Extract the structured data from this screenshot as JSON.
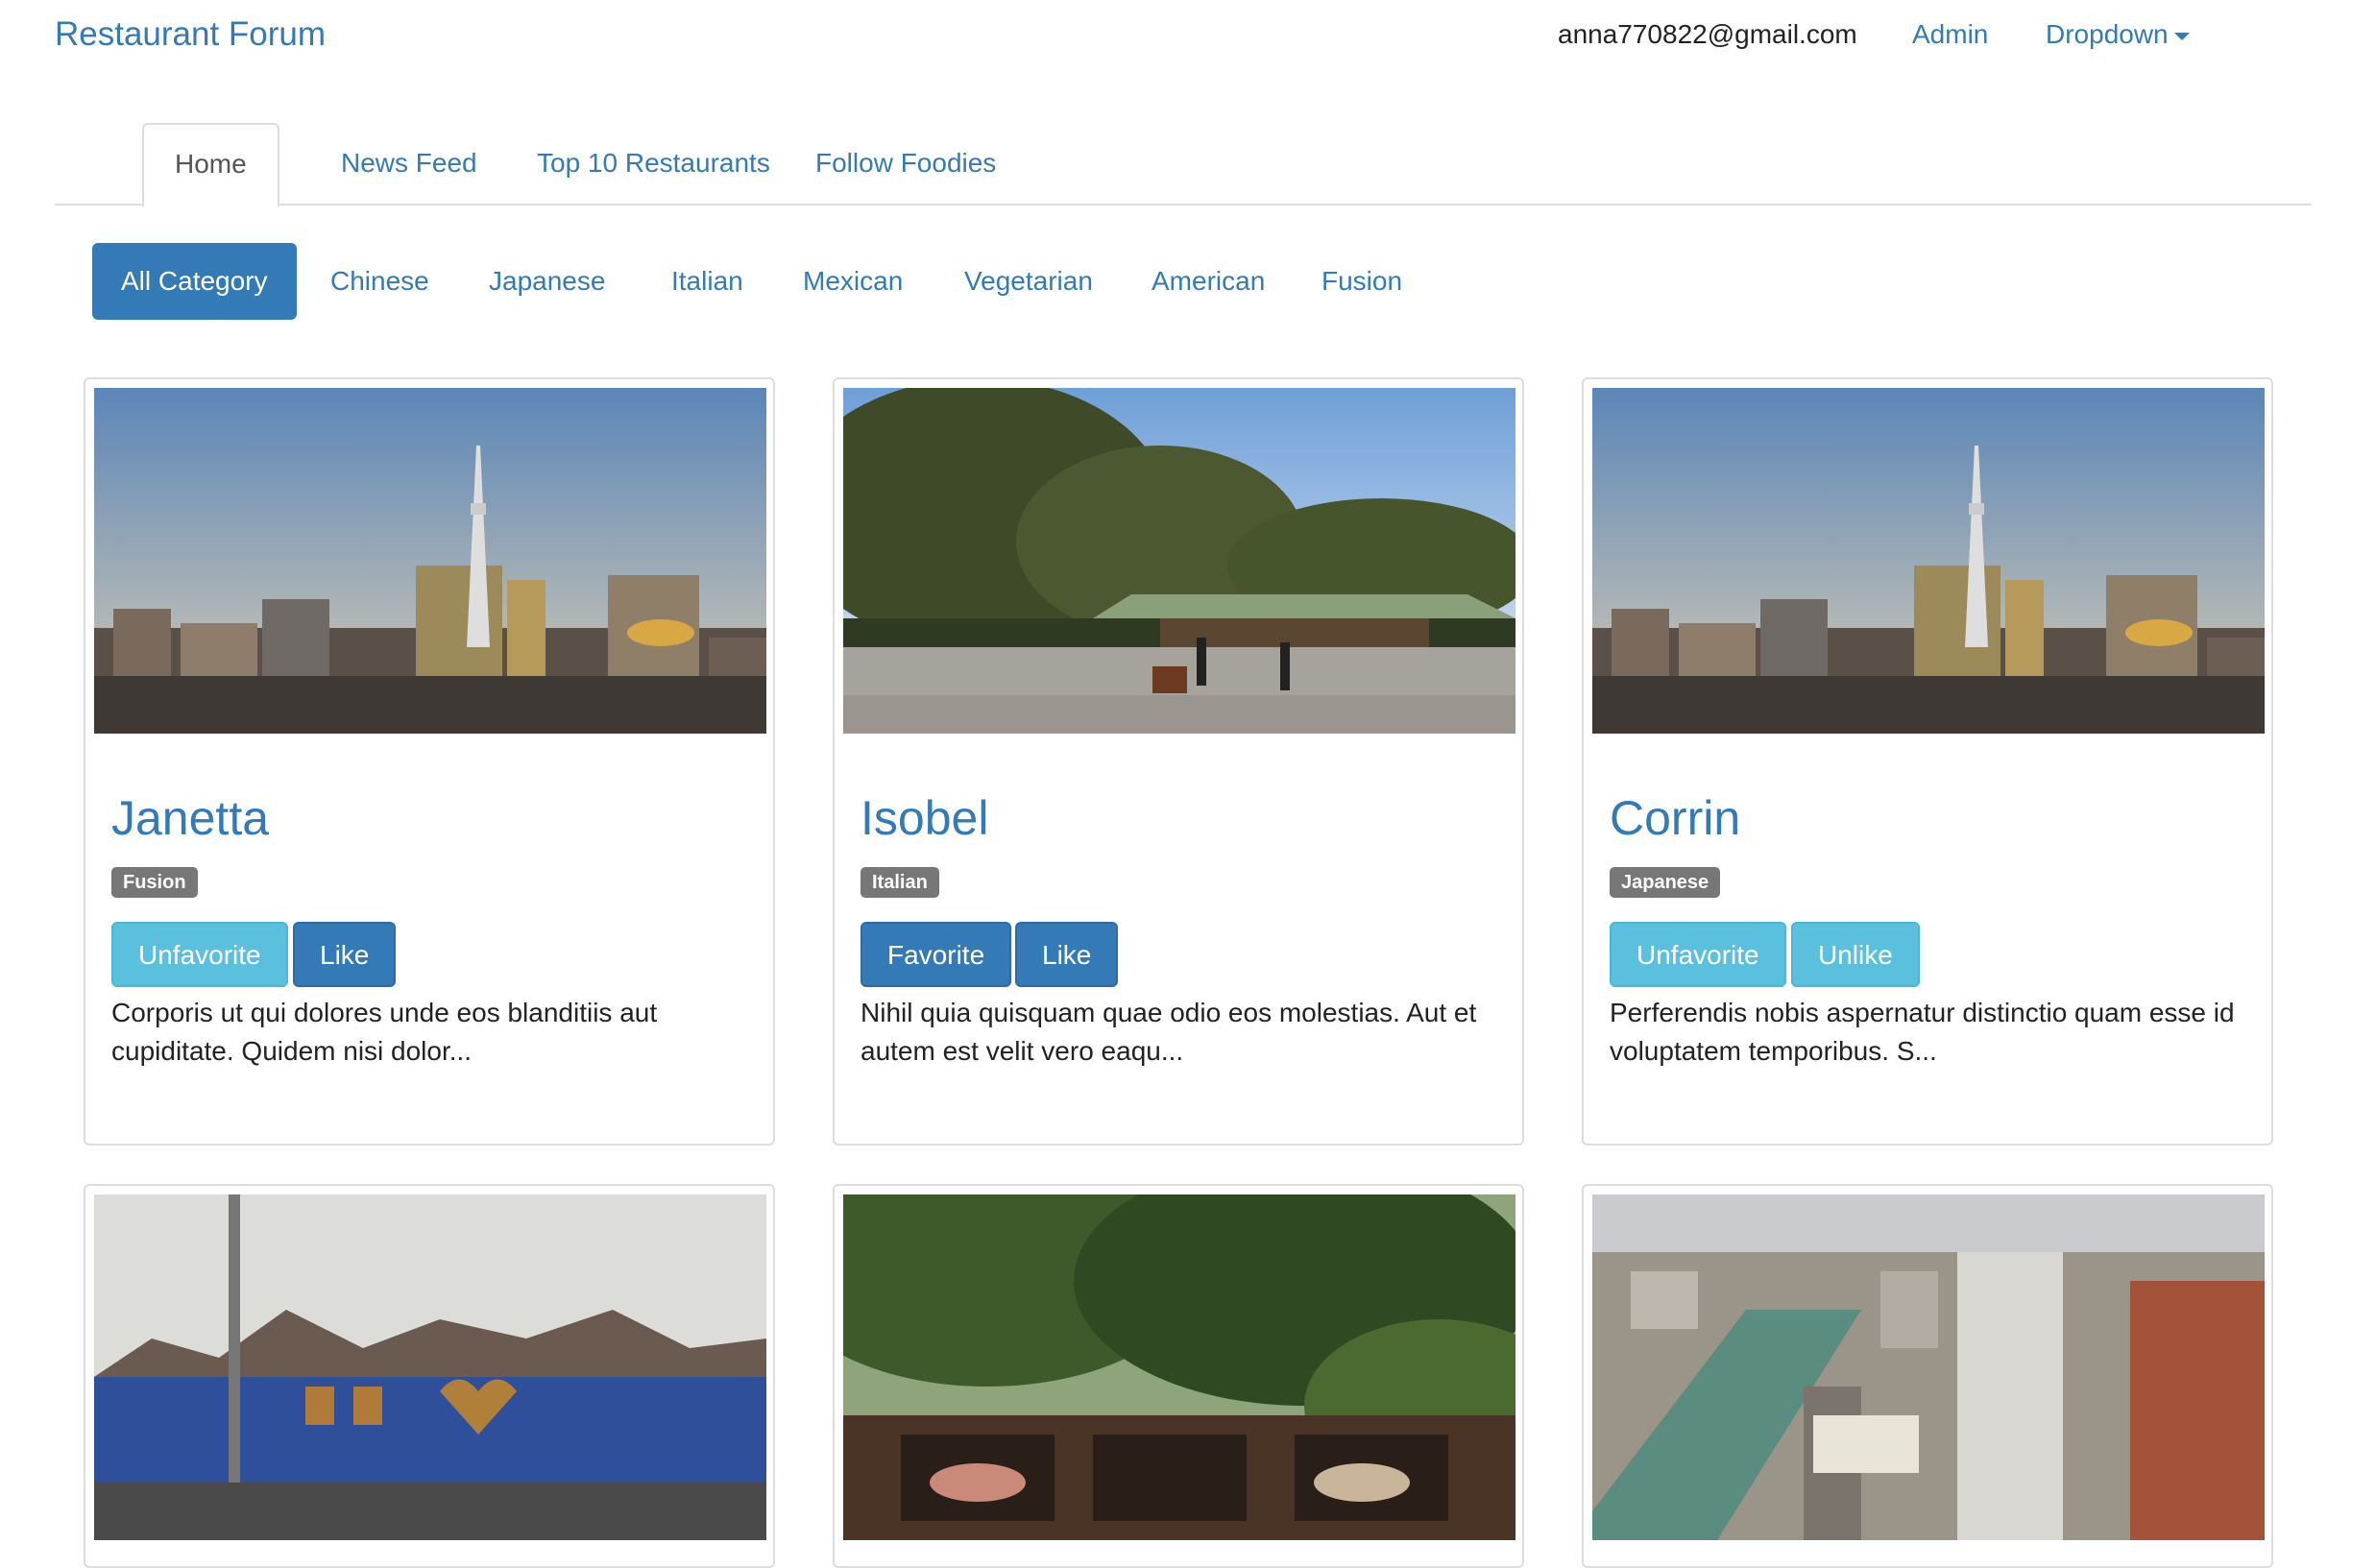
{
  "navbar": {
    "brand": "Restaurant Forum",
    "user_email": "anna770822@gmail.com",
    "admin_label": "Admin",
    "dropdown_label": "Dropdown"
  },
  "tabs": [
    {
      "label": "Home",
      "active": true
    },
    {
      "label": "News Feed"
    },
    {
      "label": "Top 10 Restaurants"
    },
    {
      "label": "Follow Foodies"
    }
  ],
  "categories": [
    {
      "label": "All Category",
      "active": true
    },
    {
      "label": "Chinese"
    },
    {
      "label": "Japanese"
    },
    {
      "label": "Italian"
    },
    {
      "label": "Mexican"
    },
    {
      "label": "Vegetarian"
    },
    {
      "label": "American"
    },
    {
      "label": "Fusion"
    }
  ],
  "restaurants": [
    {
      "name": "Janetta",
      "category": "Fusion",
      "favorite_label": "Unfavorite",
      "like_label": "Like",
      "favorite_style": "info",
      "like_style": "primary",
      "description": "Corporis ut qui dolores unde eos blanditiis aut cupiditate. Quidem nisi dolor...",
      "image": "tokyo-skyline"
    },
    {
      "name": "Isobel",
      "category": "Italian",
      "favorite_label": "Favorite",
      "like_label": "Like",
      "favorite_style": "primary",
      "like_style": "primary",
      "description": "Nihil quia quisquam quae odio eos molestias. Aut et autem est velit vero eaqu...",
      "image": "temple-trees"
    },
    {
      "name": "Corrin",
      "category": "Japanese",
      "favorite_label": "Unfavorite",
      "like_label": "Unlike",
      "favorite_style": "info",
      "like_style": "info",
      "description": "Perferendis nobis aspernatur distinctio quam esse id voluptatem temporibus. S...",
      "image": "tokyo-skyline"
    },
    {
      "image": "blue-building-street"
    },
    {
      "image": "tropical-patio"
    },
    {
      "image": "city-aerial"
    }
  ],
  "colors": {
    "link": "#337ab7",
    "primary": "#337ab7",
    "info": "#5bc0de",
    "badge": "#777777"
  }
}
